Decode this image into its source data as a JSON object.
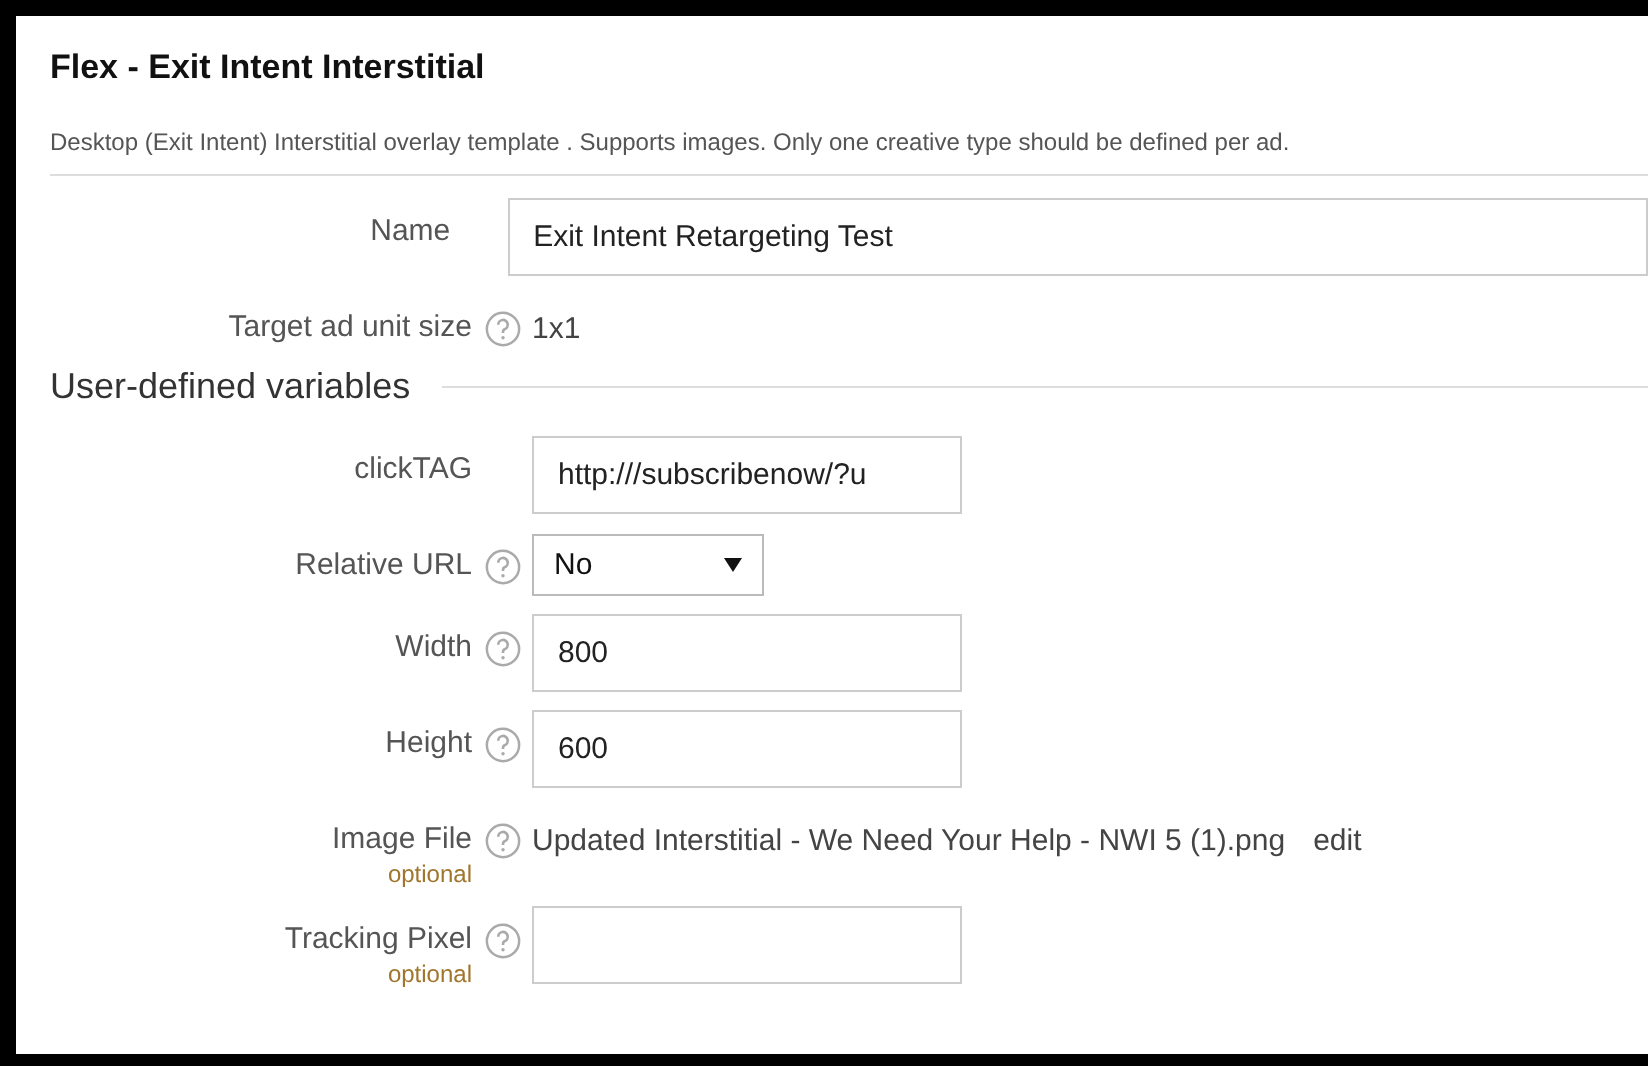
{
  "panel": {
    "title": "Flex - Exit Intent Interstitial",
    "description": "Desktop (Exit Intent) Interstitial overlay template . Supports images. Only one creative type should be defined per ad.",
    "fields": [
      {
        "kind": "text",
        "label": "Name",
        "help": false,
        "value": "Exit Intent Retargeting Test",
        "wide": true
      },
      {
        "kind": "static",
        "label": "Target ad unit size",
        "help": true,
        "value": "1x1"
      }
    ],
    "section": {
      "title": "User-defined variables",
      "fields": [
        {
          "kind": "text",
          "label": "clickTAG",
          "help": false,
          "value": "http:///subscribenow/?u"
        },
        {
          "kind": "select",
          "label": "Relative URL",
          "help": true,
          "value": "No"
        },
        {
          "kind": "text",
          "label": "Width",
          "help": true,
          "value": "800"
        },
        {
          "kind": "text",
          "label": "Height",
          "help": true,
          "value": "600"
        },
        {
          "kind": "file",
          "label": "Image File",
          "help": true,
          "optional": "optional",
          "value": "Updated Interstitial - We Need Your Help - NWI 5 (1).png",
          "action": "edit"
        },
        {
          "kind": "text",
          "label": "Tracking Pixel",
          "help": true,
          "optional": "optional"
        }
      ]
    }
  }
}
